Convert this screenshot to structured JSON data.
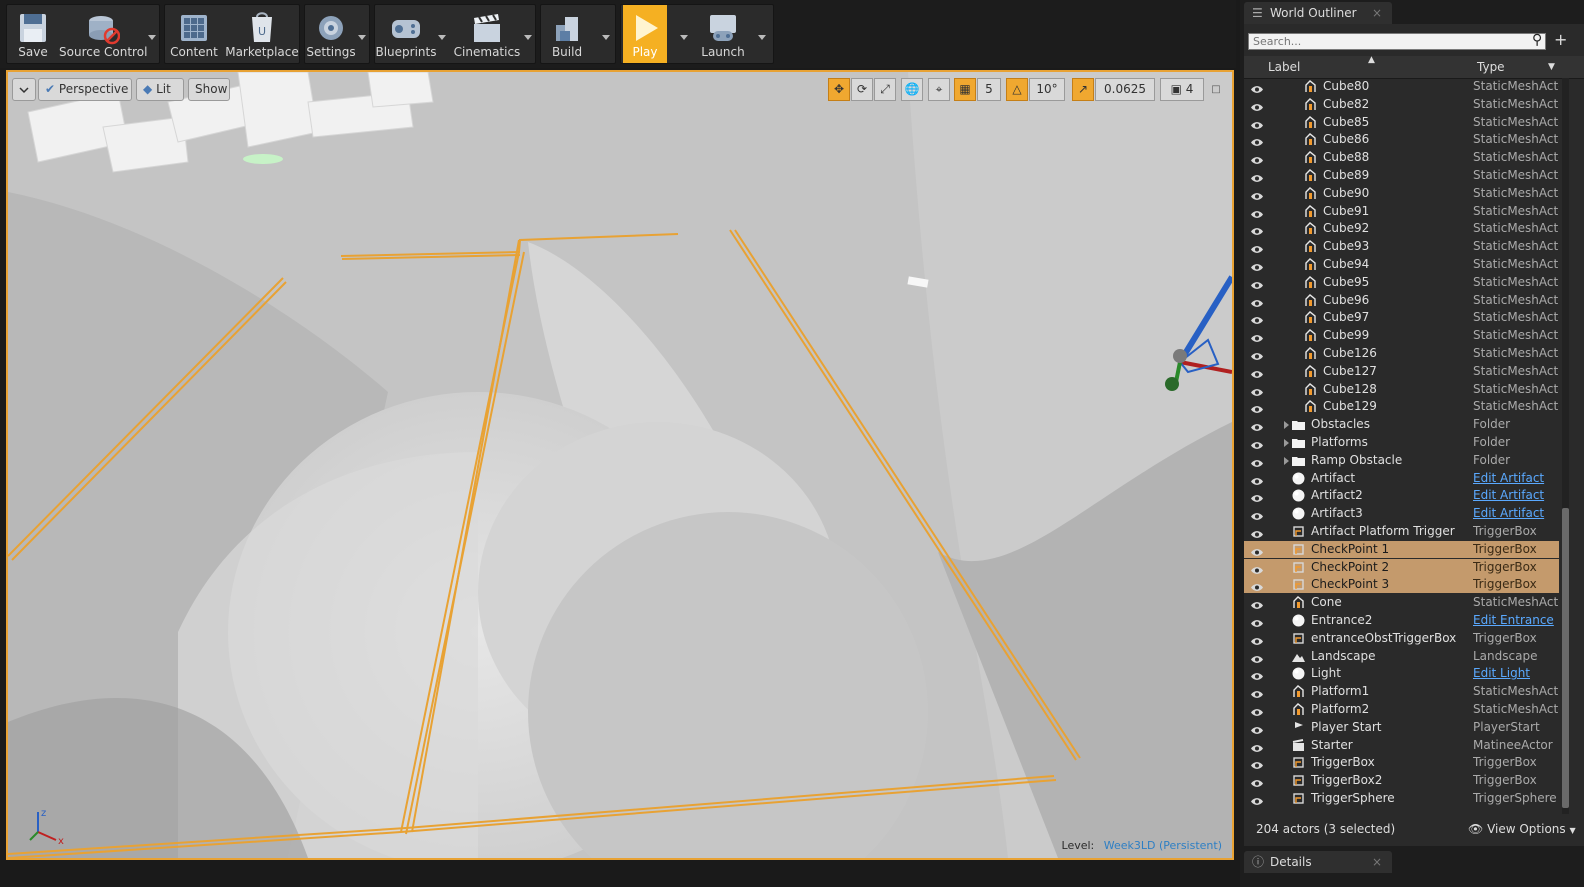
{
  "toolbar": {
    "save": "Save",
    "source_control": "Source Control",
    "content": "Content",
    "marketplace": "Marketplace",
    "settings": "Settings",
    "blueprints": "Blueprints",
    "cinematics": "Cinematics",
    "build": "Build",
    "play": "Play",
    "launch": "Launch"
  },
  "viewport": {
    "perspective": "Perspective",
    "lit": "Lit",
    "show": "Show",
    "grid_snap": "5",
    "rotation_snap": "10°",
    "scale_snap": "0.0625",
    "camera_speed": "4",
    "level_prefix": "Level:",
    "level_name": "Week3LD (Persistent)",
    "selection_color": "#e8a234"
  },
  "outliner": {
    "tab_title": "World Outliner",
    "search_placeholder": "Search...",
    "col_label": "Label",
    "col_type": "Type",
    "footer_count": "204 actors (3 selected)",
    "view_options": "View Options",
    "rows": [
      {
        "label": "Cube80",
        "type": "StaticMeshActo",
        "icon": "static-mesh-icon",
        "indent": 2,
        "selected": false,
        "link": false
      },
      {
        "label": "Cube82",
        "type": "StaticMeshActo",
        "icon": "static-mesh-icon",
        "indent": 2,
        "selected": false,
        "link": false
      },
      {
        "label": "Cube85",
        "type": "StaticMeshActo",
        "icon": "static-mesh-icon",
        "indent": 2,
        "selected": false,
        "link": false
      },
      {
        "label": "Cube86",
        "type": "StaticMeshActo",
        "icon": "static-mesh-icon",
        "indent": 2,
        "selected": false,
        "link": false
      },
      {
        "label": "Cube88",
        "type": "StaticMeshActo",
        "icon": "static-mesh-icon",
        "indent": 2,
        "selected": false,
        "link": false
      },
      {
        "label": "Cube89",
        "type": "StaticMeshActo",
        "icon": "static-mesh-icon",
        "indent": 2,
        "selected": false,
        "link": false
      },
      {
        "label": "Cube90",
        "type": "StaticMeshActo",
        "icon": "static-mesh-icon",
        "indent": 2,
        "selected": false,
        "link": false
      },
      {
        "label": "Cube91",
        "type": "StaticMeshActo",
        "icon": "static-mesh-icon",
        "indent": 2,
        "selected": false,
        "link": false
      },
      {
        "label": "Cube92",
        "type": "StaticMeshActo",
        "icon": "static-mesh-icon",
        "indent": 2,
        "selected": false,
        "link": false
      },
      {
        "label": "Cube93",
        "type": "StaticMeshActo",
        "icon": "static-mesh-icon",
        "indent": 2,
        "selected": false,
        "link": false
      },
      {
        "label": "Cube94",
        "type": "StaticMeshActo",
        "icon": "static-mesh-icon",
        "indent": 2,
        "selected": false,
        "link": false
      },
      {
        "label": "Cube95",
        "type": "StaticMeshActo",
        "icon": "static-mesh-icon",
        "indent": 2,
        "selected": false,
        "link": false
      },
      {
        "label": "Cube96",
        "type": "StaticMeshActo",
        "icon": "static-mesh-icon",
        "indent": 2,
        "selected": false,
        "link": false
      },
      {
        "label": "Cube97",
        "type": "StaticMeshActo",
        "icon": "static-mesh-icon",
        "indent": 2,
        "selected": false,
        "link": false
      },
      {
        "label": "Cube99",
        "type": "StaticMeshActo",
        "icon": "static-mesh-icon",
        "indent": 2,
        "selected": false,
        "link": false
      },
      {
        "label": "Cube126",
        "type": "StaticMeshActo",
        "icon": "static-mesh-icon",
        "indent": 2,
        "selected": false,
        "link": false
      },
      {
        "label": "Cube127",
        "type": "StaticMeshActo",
        "icon": "static-mesh-icon",
        "indent": 2,
        "selected": false,
        "link": false
      },
      {
        "label": "Cube128",
        "type": "StaticMeshActo",
        "icon": "static-mesh-icon",
        "indent": 2,
        "selected": false,
        "link": false
      },
      {
        "label": "Cube129",
        "type": "StaticMeshActo",
        "icon": "static-mesh-icon",
        "indent": 2,
        "selected": false,
        "link": false
      },
      {
        "label": "Obstacles",
        "type": "Folder",
        "icon": "folder-icon",
        "indent": 1,
        "selected": false,
        "link": false,
        "expandable": true
      },
      {
        "label": "Platforms",
        "type": "Folder",
        "icon": "folder-icon",
        "indent": 1,
        "selected": false,
        "link": false,
        "expandable": true
      },
      {
        "label": "Ramp Obstacle",
        "type": "Folder",
        "icon": "folder-icon",
        "indent": 1,
        "selected": false,
        "link": false,
        "expandable": true
      },
      {
        "label": "Artifact",
        "type": "Edit Artifact",
        "icon": "blueprint-sphere-icon",
        "indent": 1,
        "selected": false,
        "link": true
      },
      {
        "label": "Artifact2",
        "type": "Edit Artifact",
        "icon": "blueprint-sphere-icon",
        "indent": 1,
        "selected": false,
        "link": true
      },
      {
        "label": "Artifact3",
        "type": "Edit Artifact",
        "icon": "blueprint-sphere-icon",
        "indent": 1,
        "selected": false,
        "link": true
      },
      {
        "label": "Artifact Platform Trigger",
        "type": "TriggerBox",
        "icon": "trigger-box-icon",
        "indent": 1,
        "selected": false,
        "link": false
      },
      {
        "label": "CheckPoint 1",
        "type": "TriggerBox",
        "icon": "trigger-box-icon",
        "indent": 1,
        "selected": true,
        "link": false
      },
      {
        "label": "CheckPoint 2",
        "type": "TriggerBox",
        "icon": "trigger-box-icon",
        "indent": 1,
        "selected": true,
        "link": false
      },
      {
        "label": "CheckPoint 3",
        "type": "TriggerBox",
        "icon": "trigger-box-icon",
        "indent": 1,
        "selected": true,
        "link": false
      },
      {
        "label": "Cone",
        "type": "StaticMeshActo",
        "icon": "static-mesh-icon",
        "indent": 1,
        "selected": false,
        "link": false
      },
      {
        "label": "Entrance2",
        "type": "Edit Entrance",
        "icon": "blueprint-sphere-icon",
        "indent": 1,
        "selected": false,
        "link": true
      },
      {
        "label": "entranceObstTriggerBox",
        "type": "TriggerBox",
        "icon": "trigger-box-icon",
        "indent": 1,
        "selected": false,
        "link": false
      },
      {
        "label": "Landscape",
        "type": "Landscape",
        "icon": "landscape-icon",
        "indent": 1,
        "selected": false,
        "link": false
      },
      {
        "label": "Light",
        "type": "Edit Light",
        "icon": "blueprint-sphere-icon",
        "indent": 1,
        "selected": false,
        "link": true
      },
      {
        "label": "Platform1",
        "type": "StaticMeshActo",
        "icon": "static-mesh-icon",
        "indent": 1,
        "selected": false,
        "link": false
      },
      {
        "label": "Platform2",
        "type": "StaticMeshActo",
        "icon": "static-mesh-icon",
        "indent": 1,
        "selected": false,
        "link": false
      },
      {
        "label": "Player Start",
        "type": "PlayerStart",
        "icon": "player-start-icon",
        "indent": 1,
        "selected": false,
        "link": false
      },
      {
        "label": "Starter",
        "type": "MatineeActor",
        "icon": "matinee-icon",
        "indent": 1,
        "selected": false,
        "link": false
      },
      {
        "label": "TriggerBox",
        "type": "TriggerBox",
        "icon": "trigger-box-icon",
        "indent": 1,
        "selected": false,
        "link": false
      },
      {
        "label": "TriggerBox2",
        "type": "TriggerBox",
        "icon": "trigger-box-icon",
        "indent": 1,
        "selected": false,
        "link": false
      },
      {
        "label": "TriggerSphere",
        "type": "TriggerSphere",
        "icon": "trigger-box-icon",
        "indent": 1,
        "selected": false,
        "link": false
      }
    ]
  },
  "details": {
    "tab_title": "Details"
  }
}
